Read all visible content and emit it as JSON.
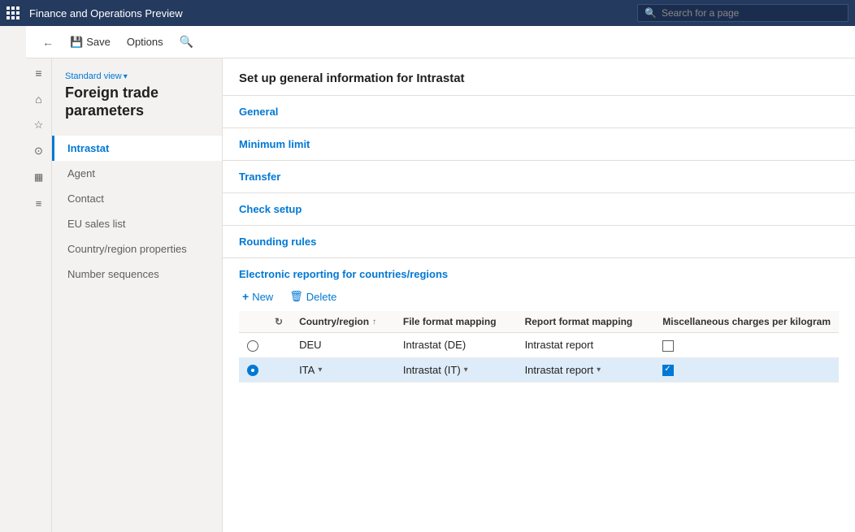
{
  "app": {
    "title": "Finance and Operations Preview",
    "search_placeholder": "Search for a page"
  },
  "toolbar": {
    "back_label": "",
    "save_label": "Save",
    "options_label": "Options",
    "search_label": ""
  },
  "sidebar": {
    "view_label": "Standard view",
    "page_title": "Foreign trade parameters",
    "nav_items": [
      {
        "id": "intrastat",
        "label": "Intrastat",
        "active": true
      },
      {
        "id": "agent",
        "label": "Agent",
        "active": false
      },
      {
        "id": "contact",
        "label": "Contact",
        "active": false
      },
      {
        "id": "eu-sales-list",
        "label": "EU sales list",
        "active": false
      },
      {
        "id": "country-region-properties",
        "label": "Country/region properties",
        "active": false
      },
      {
        "id": "number-sequences",
        "label": "Number sequences",
        "active": false
      }
    ]
  },
  "main_panel": {
    "header": "Set up general information for Intrastat",
    "sections": [
      {
        "id": "general",
        "label": "General"
      },
      {
        "id": "minimum-limit",
        "label": "Minimum limit"
      },
      {
        "id": "transfer",
        "label": "Transfer"
      },
      {
        "id": "check-setup",
        "label": "Check setup"
      },
      {
        "id": "rounding-rules",
        "label": "Rounding rules"
      }
    ],
    "er_section": {
      "title": "Electronic reporting for countries/regions",
      "new_label": "New",
      "delete_label": "Delete",
      "columns": [
        {
          "id": "radio",
          "label": ""
        },
        {
          "id": "refresh",
          "label": ""
        },
        {
          "id": "country-region",
          "label": "Country/region"
        },
        {
          "id": "sort",
          "label": ""
        },
        {
          "id": "file-format-mapping",
          "label": "File format mapping"
        },
        {
          "id": "report-format-mapping",
          "label": "Report format mapping"
        },
        {
          "id": "misc-charges",
          "label": "Miscellaneous charges per kilogram"
        }
      ],
      "rows": [
        {
          "id": "row-deu",
          "selected": false,
          "radio_selected": false,
          "country_region": "DEU",
          "file_format_mapping": "Intrastat (DE)",
          "report_format_mapping": "Intrastat report",
          "misc_checked": false
        },
        {
          "id": "row-ita",
          "selected": true,
          "radio_selected": true,
          "country_region": "ITA",
          "file_format_mapping": "Intrastat (IT)",
          "report_format_mapping": "Intrastat report",
          "misc_checked": true
        }
      ]
    }
  },
  "left_icons": [
    {
      "id": "hamburger",
      "symbol": "≡"
    },
    {
      "id": "home",
      "symbol": "⌂"
    },
    {
      "id": "favorites",
      "symbol": "☆"
    },
    {
      "id": "recent",
      "symbol": "🕐"
    },
    {
      "id": "workspaces",
      "symbol": "⊞"
    },
    {
      "id": "modules",
      "symbol": "☰"
    }
  ]
}
